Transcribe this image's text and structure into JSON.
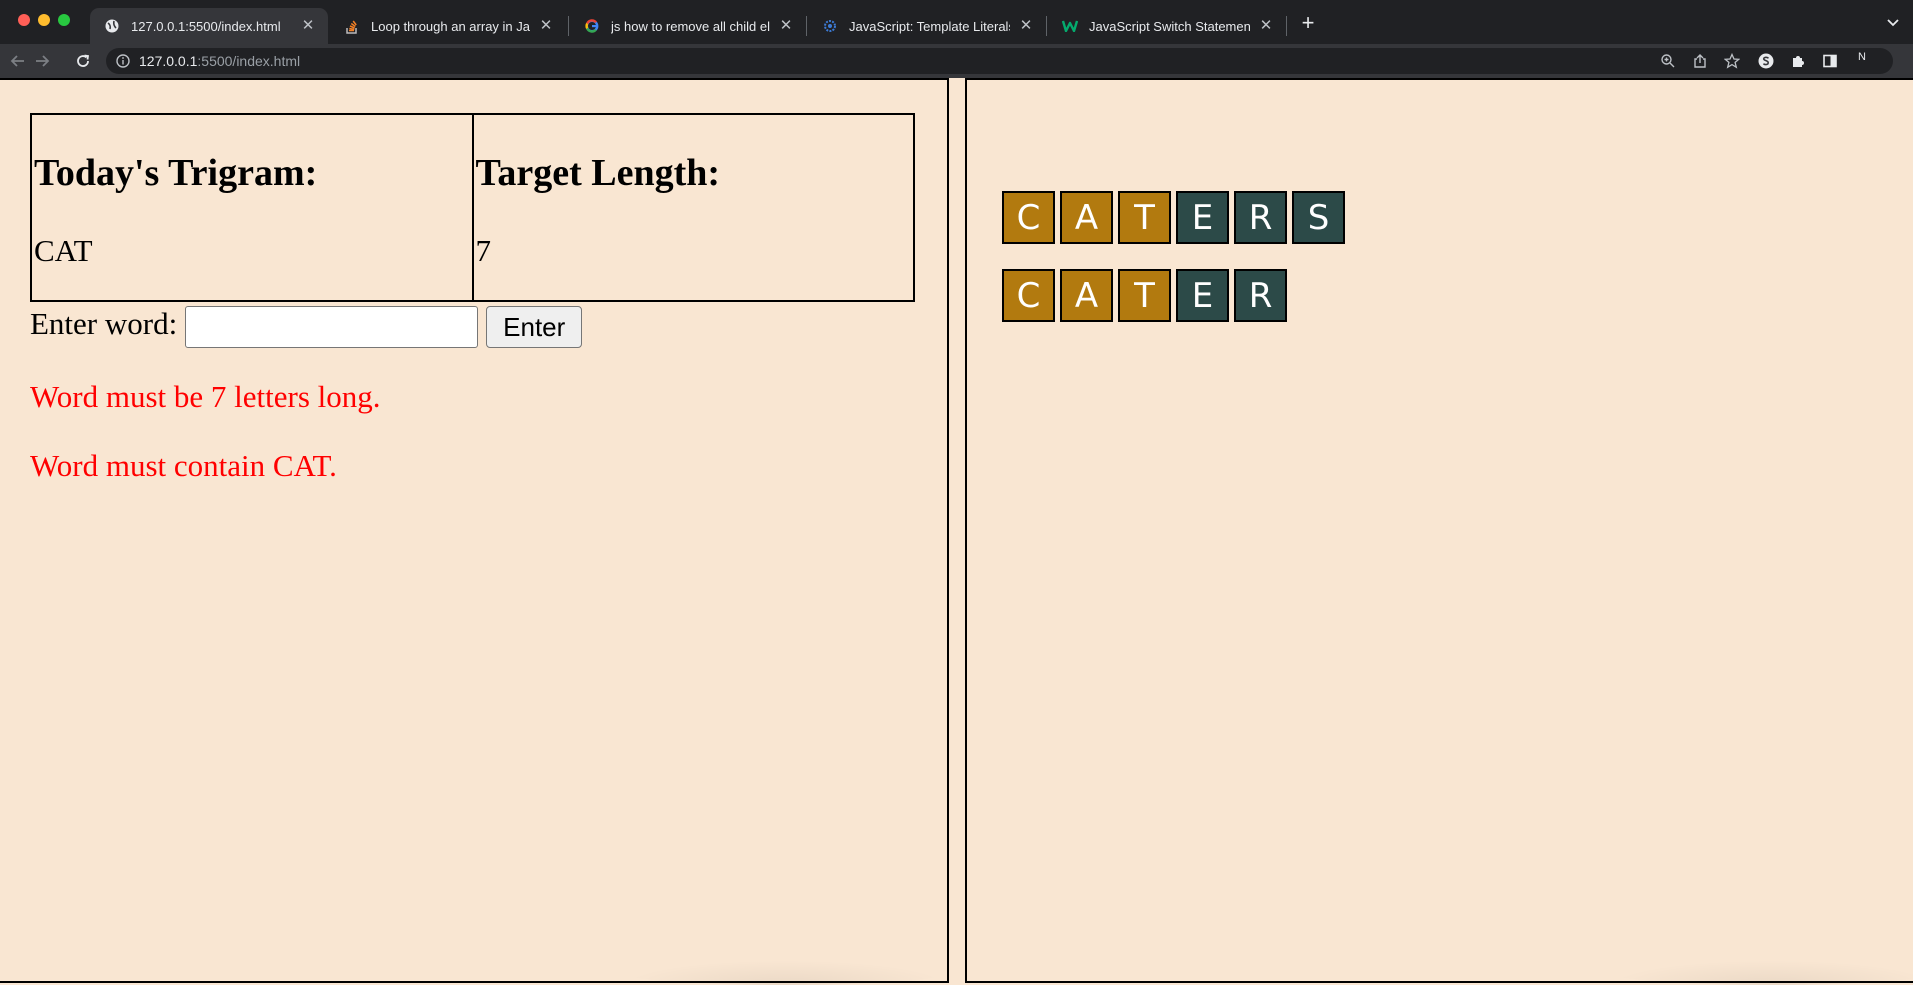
{
  "browser": {
    "tabs": [
      {
        "title": "127.0.0.1:5500/index.html",
        "favicon": "globe-icon",
        "active": true
      },
      {
        "title": "Loop through an array in JavaS",
        "favicon": "stackoverflow-icon",
        "active": false
      },
      {
        "title": "js how to remove all child elem",
        "favicon": "google-icon",
        "active": false
      },
      {
        "title": "JavaScript: Template Literals &",
        "favicon": "gear-icon",
        "active": false
      },
      {
        "title": "JavaScript Switch Statement",
        "favicon": "w3schools-icon",
        "active": false
      }
    ],
    "close_glyph": "✕",
    "new_tab_glyph": "+",
    "url_host": "127.0.0.1",
    "url_rest": ":5500/index.html",
    "profile_initial": "N"
  },
  "game": {
    "trigram_heading": "Today's Trigram:",
    "trigram_value": "CAT",
    "length_heading": "Target Length:",
    "length_value": "7",
    "entry_label": "Enter word:",
    "entry_value": "",
    "enter_button": "Enter",
    "errors": [
      "Word must be 7 letters long.",
      "Word must contain CAT."
    ],
    "guesses": [
      {
        "letters": [
          "C",
          "A",
          "T",
          "E",
          "R",
          "S"
        ],
        "states": [
          "gold",
          "gold",
          "gold",
          "dark",
          "dark",
          "dark"
        ]
      },
      {
        "letters": [
          "C",
          "A",
          "T",
          "E",
          "R"
        ],
        "states": [
          "gold",
          "gold",
          "gold",
          "dark",
          "dark"
        ]
      }
    ],
    "colors": {
      "gold": "#b27a0f",
      "dark": "#2c4a48",
      "error": "#ff0000",
      "background": "#f9e6d2"
    }
  }
}
